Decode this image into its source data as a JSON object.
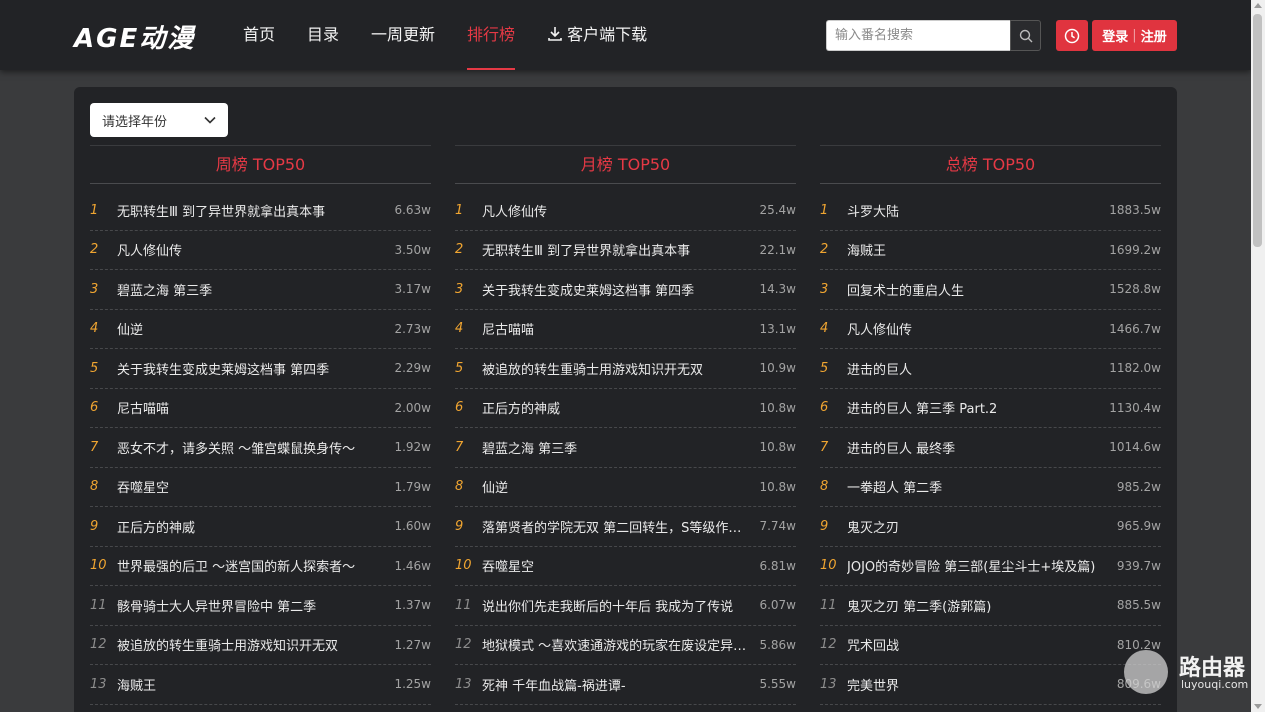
{
  "header": {
    "logo": "AGE动漫",
    "nav": [
      {
        "label": "首页",
        "active": false
      },
      {
        "label": "目录",
        "active": false
      },
      {
        "label": "一周更新",
        "active": false
      },
      {
        "label": "排行榜",
        "active": true
      },
      {
        "label": "客户端下载",
        "active": false,
        "icon": "download-icon"
      }
    ],
    "search_placeholder": "输入番名搜索",
    "login": "登录",
    "register": "注册",
    "accent_color": "#e0343f"
  },
  "filter": {
    "year_select": "请选择年份"
  },
  "columns": [
    {
      "title": "周榜 TOP50",
      "items": [
        {
          "rank": "1",
          "name": "无职转生Ⅲ 到了异世界就拿出真本事",
          "value": "6.63w"
        },
        {
          "rank": "2",
          "name": "凡人修仙传",
          "value": "3.50w"
        },
        {
          "rank": "3",
          "name": "碧蓝之海 第三季",
          "value": "3.17w"
        },
        {
          "rank": "4",
          "name": "仙逆",
          "value": "2.73w"
        },
        {
          "rank": "5",
          "name": "关于我转生变成史莱姆这档事 第四季",
          "value": "2.29w"
        },
        {
          "rank": "6",
          "name": "尼古喵喵",
          "value": "2.00w"
        },
        {
          "rank": "7",
          "name": "恶女不才，请多关照 ～雏宫蝶鼠换身传～",
          "value": "1.92w"
        },
        {
          "rank": "8",
          "name": "吞噬星空",
          "value": "1.79w"
        },
        {
          "rank": "9",
          "name": "正后方的神威",
          "value": "1.60w"
        },
        {
          "rank": "10",
          "name": "世界最强的后卫 ～迷宫国的新人探索者～",
          "value": "1.46w"
        },
        {
          "rank": "11",
          "name": "骸骨骑士大人异世界冒险中 第二季",
          "value": "1.37w"
        },
        {
          "rank": "12",
          "name": "被追放的转生重骑士用游戏知识开无双",
          "value": "1.27w"
        },
        {
          "rank": "13",
          "name": "海贼王",
          "value": "1.25w"
        }
      ]
    },
    {
      "title": "月榜 TOP50",
      "items": [
        {
          "rank": "1",
          "name": "凡人修仙传",
          "value": "25.4w"
        },
        {
          "rank": "2",
          "name": "无职转生Ⅲ 到了异世界就拿出真本事",
          "value": "22.1w"
        },
        {
          "rank": "3",
          "name": "关于我转生变成史莱姆这档事 第四季",
          "value": "14.3w"
        },
        {
          "rank": "4",
          "name": "尼古喵喵",
          "value": "13.1w"
        },
        {
          "rank": "5",
          "name": "被追放的转生重骑士用游戏知识开无双",
          "value": "10.9w"
        },
        {
          "rank": "6",
          "name": "正后方的神威",
          "value": "10.8w"
        },
        {
          "rank": "7",
          "name": "碧蓝之海 第三季",
          "value": "10.8w"
        },
        {
          "rank": "8",
          "name": "仙逆",
          "value": "10.8w"
        },
        {
          "rank": "9",
          "name": "落第贤者的学院无双 第二回转生，S等级作…",
          "value": "7.74w"
        },
        {
          "rank": "10",
          "name": "吞噬星空",
          "value": "6.81w"
        },
        {
          "rank": "11",
          "name": "说出你们先走我断后的十年后 我成为了传说",
          "value": "6.07w"
        },
        {
          "rank": "12",
          "name": "地狱模式 ～喜欢速通游戏的玩家在废设定异…",
          "value": "5.86w"
        },
        {
          "rank": "13",
          "name": "死神 千年血战篇-祸进谭-",
          "value": "5.55w"
        }
      ]
    },
    {
      "title": "总榜 TOP50",
      "items": [
        {
          "rank": "1",
          "name": "斗罗大陆",
          "value": "1883.5w"
        },
        {
          "rank": "2",
          "name": "海贼王",
          "value": "1699.2w"
        },
        {
          "rank": "3",
          "name": "回复术士的重启人生",
          "value": "1528.8w"
        },
        {
          "rank": "4",
          "name": "凡人修仙传",
          "value": "1466.7w"
        },
        {
          "rank": "5",
          "name": "进击的巨人",
          "value": "1182.0w"
        },
        {
          "rank": "6",
          "name": "进击的巨人 第三季 Part.2",
          "value": "1130.4w"
        },
        {
          "rank": "7",
          "name": "进击的巨人 最终季",
          "value": "1014.6w"
        },
        {
          "rank": "8",
          "name": "一拳超人 第二季",
          "value": "985.2w"
        },
        {
          "rank": "9",
          "name": "鬼灭之刃",
          "value": "965.9w"
        },
        {
          "rank": "10",
          "name": "JOJO的奇妙冒险 第三部(星尘斗士+埃及篇)",
          "value": "939.7w"
        },
        {
          "rank": "11",
          "name": "鬼灭之刃 第二季(游郭篇)",
          "value": "885.5w"
        },
        {
          "rank": "12",
          "name": "咒术回战",
          "value": "810.2w"
        },
        {
          "rank": "13",
          "name": "完美世界",
          "value": "809.6w"
        }
      ]
    }
  ],
  "watermark": {
    "text": "路由器",
    "url": "luyouqi.com"
  }
}
